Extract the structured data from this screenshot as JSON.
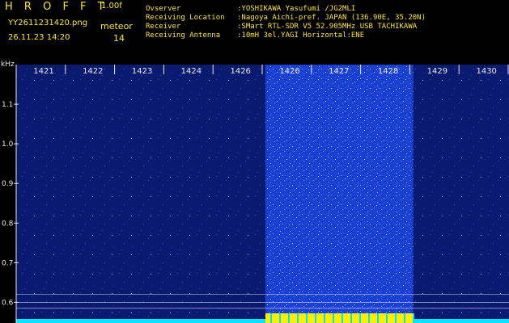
{
  "header": {
    "app_title": "H R O F F T",
    "version": "1.00f",
    "file_name": "YY2611231420.png",
    "timestamp": "26.11.23 14:20",
    "event_label": "meteor",
    "event_count": "14"
  },
  "station": [
    {
      "key": "Ovserver",
      "value": ":YOSHIKAWA Yasufumi /JG2MLI"
    },
    {
      "key": "Receiving Location",
      "value": ":Nagoya Aichi-pref. JAPAN (136.90E, 35.20N)"
    },
    {
      "key": "Receiver",
      "value": ":SMart RTL-SDR V5 52.905MHz USB TACHIKAWA"
    },
    {
      "key": "Receiving Antenna",
      "value": ":10mH 3el.YAGI Horizontal:ENE"
    }
  ],
  "y_unit": "kHz",
  "colors": {
    "background": "#000000",
    "spectrogram_base": "#0a1a6e",
    "noise_band": "#1a3cd8",
    "signal_line": "#00e5ff",
    "burst_line": "#ffee00",
    "text": "#e8e8e8",
    "header_text": "#ffe62a"
  },
  "chart_data": {
    "type": "heatmap",
    "title": "",
    "xlabel": "",
    "ylabel": "kHz",
    "x_ticks": [
      "1421",
      "1422",
      "1423",
      "1424",
      "1426",
      "1426",
      "1427",
      "1428",
      "1429",
      "1430"
    ],
    "y_ticks": [
      "1.1",
      "1.0",
      "0.9",
      "0.8",
      "0.7",
      "0.6"
    ],
    "ylim": [
      0.56,
      1.2
    ],
    "high_noise_interval": {
      "start_minute": "1426",
      "end_minute": "1429",
      "end_fraction_of_minute": 0.2
    },
    "horizontal_lines_khz": [
      0.62,
      0.6,
      0.585
    ]
  }
}
